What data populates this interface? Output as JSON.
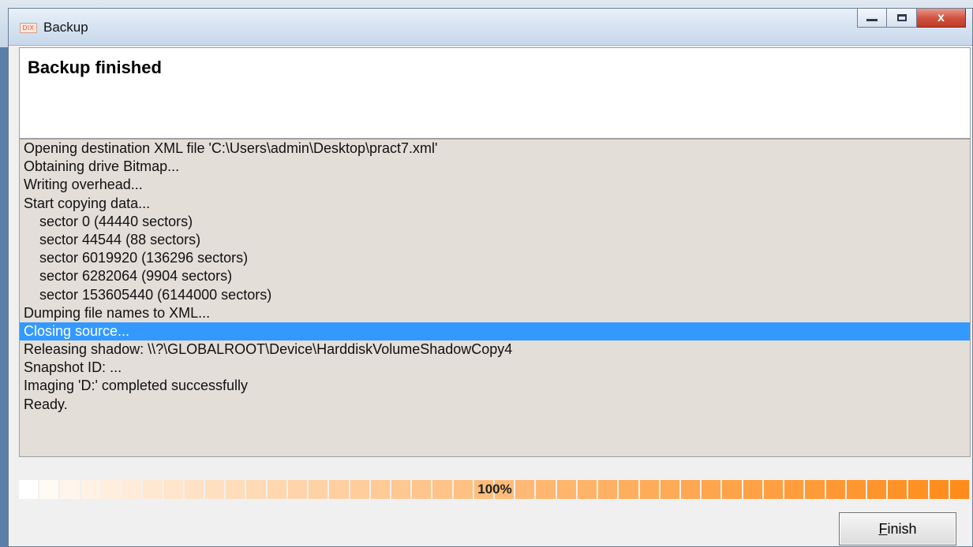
{
  "window": {
    "title": "Backup",
    "app_icon_text": "DIX",
    "controls": {
      "minimize": "minimize",
      "maximize": "maximize",
      "close_symbol": "x"
    }
  },
  "header": {
    "title": "Backup finished"
  },
  "log": {
    "lines": [
      {
        "text": "Opening destination XML file 'C:\\Users\\admin\\Desktop\\pract7.xml'",
        "indent": false,
        "selected": false
      },
      {
        "text": "Obtaining drive Bitmap...",
        "indent": false,
        "selected": false
      },
      {
        "text": "Writing overhead...",
        "indent": false,
        "selected": false
      },
      {
        "text": "Start copying data...",
        "indent": false,
        "selected": false
      },
      {
        "text": "sector 0 (44440 sectors)",
        "indent": true,
        "selected": false
      },
      {
        "text": "sector 44544 (88 sectors)",
        "indent": true,
        "selected": false
      },
      {
        "text": "sector 6019920 (136296 sectors)",
        "indent": true,
        "selected": false
      },
      {
        "text": "sector 6282064 (9904 sectors)",
        "indent": true,
        "selected": false
      },
      {
        "text": "sector 153605440 (6144000 sectors)",
        "indent": true,
        "selected": false
      },
      {
        "text": "Dumping file names to XML...",
        "indent": false,
        "selected": false
      },
      {
        "text": "Closing source...",
        "indent": false,
        "selected": true
      },
      {
        "text": "Releasing shadow: \\\\?\\GLOBALROOT\\Device\\HarddiskVolumeShadowCopy4",
        "indent": false,
        "selected": false
      },
      {
        "text": "Snapshot ID: ...",
        "indent": false,
        "selected": false
      },
      {
        "text": "Imaging 'D:' completed successfully",
        "indent": false,
        "selected": false
      },
      {
        "text": "Ready.",
        "indent": false,
        "selected": false
      }
    ]
  },
  "progress": {
    "label": "100%",
    "value": 1.0,
    "color_start": "#ffffff",
    "color_end": "#ff8c1a"
  },
  "buttons": {
    "finish_mnemonic": "F",
    "finish_rest": "inish"
  },
  "colors": {
    "selection": "#3399ff",
    "log_background": "#e3ded8"
  }
}
